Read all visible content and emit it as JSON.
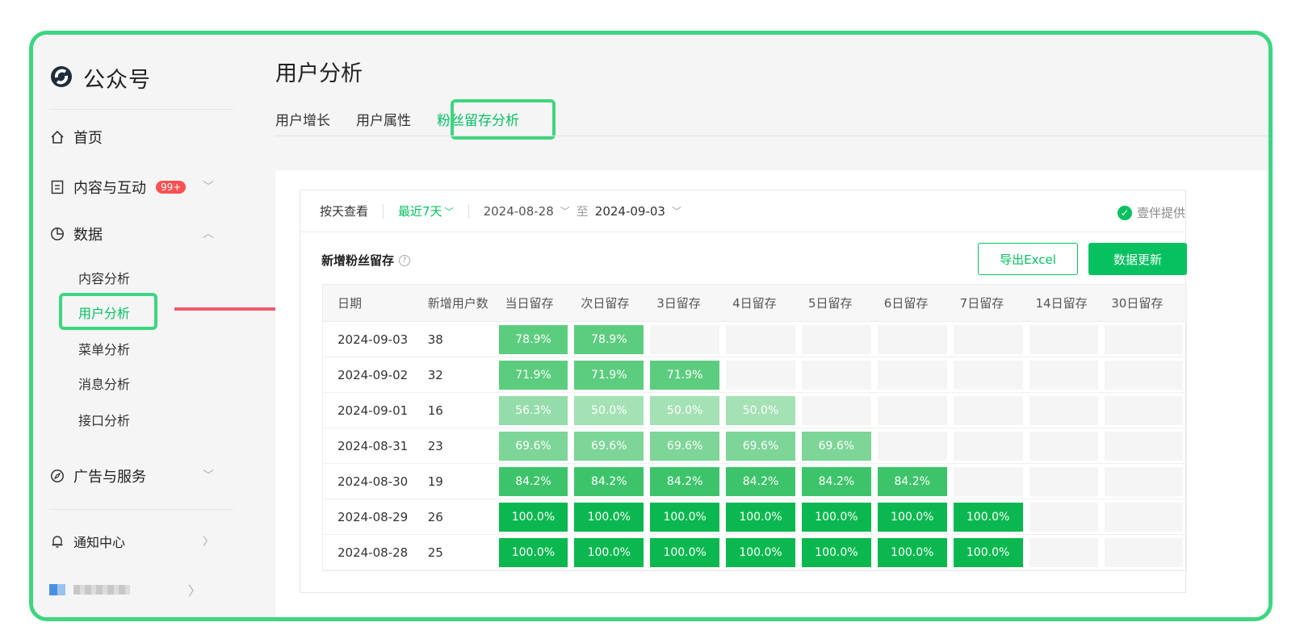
{
  "colors": {
    "accent": "#07c160",
    "highlight": "#3ed680",
    "arrow": "#f25a6b",
    "badge": "#fa5151"
  },
  "sidebar": {
    "brand": "公众号",
    "home": "首页",
    "content": "内容与互动",
    "content_badge": "99+",
    "data": "数据",
    "data_items": [
      "内容分析",
      "用户分析",
      "菜单分析",
      "消息分析",
      "接口分析"
    ],
    "ads": "广告与服务",
    "notify": "通知中心"
  },
  "header": {
    "title": "用户分析",
    "tabs": [
      "用户增长",
      "用户属性",
      "粉丝留存分析"
    ]
  },
  "filter": {
    "by_day": "按天查看",
    "range": "最近7天",
    "start": "2024-08-28",
    "to": "至",
    "end": "2024-09-03",
    "provider": "壹伴提供"
  },
  "section": {
    "title": "新增粉丝留存",
    "export_label": "导出Excel",
    "update_label": "数据更新"
  },
  "table": {
    "headers": [
      "日期",
      "新增用户数",
      "当日留存",
      "次日留存",
      "3日留存",
      "4日留存",
      "5日留存",
      "6日留存",
      "7日留存",
      "14日留存",
      "30日留存"
    ],
    "rows": [
      {
        "date": "2024-09-03",
        "count": "38",
        "retention": [
          "78.9%",
          "78.9%"
        ]
      },
      {
        "date": "2024-09-02",
        "count": "32",
        "retention": [
          "71.9%",
          "71.9%",
          "71.9%"
        ]
      },
      {
        "date": "2024-09-01",
        "count": "16",
        "retention": [
          "56.3%",
          "50.0%",
          "50.0%",
          "50.0%"
        ]
      },
      {
        "date": "2024-08-31",
        "count": "23",
        "retention": [
          "69.6%",
          "69.6%",
          "69.6%",
          "69.6%",
          "69.6%"
        ]
      },
      {
        "date": "2024-08-30",
        "count": "19",
        "retention": [
          "84.2%",
          "84.2%",
          "84.2%",
          "84.2%",
          "84.2%",
          "84.2%"
        ]
      },
      {
        "date": "2024-08-29",
        "count": "26",
        "retention": [
          "100.0%",
          "100.0%",
          "100.0%",
          "100.0%",
          "100.0%",
          "100.0%",
          "100.0%"
        ]
      },
      {
        "date": "2024-08-28",
        "count": "25",
        "retention": [
          "100.0%",
          "100.0%",
          "100.0%",
          "100.0%",
          "100.0%",
          "100.0%",
          "100.0%"
        ]
      }
    ]
  }
}
